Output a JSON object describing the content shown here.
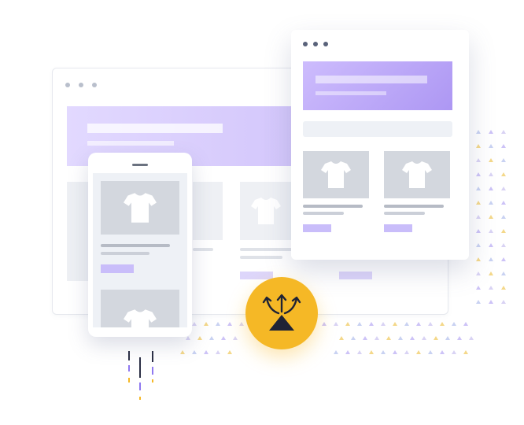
{
  "illustration": {
    "theme": "responsive-storefront",
    "colors": {
      "accent_purple": "#b7a4f6",
      "accent_yellow": "#f5b826",
      "placeholder_gray": "#d3d7de",
      "dark_navy": "#1f2335"
    },
    "icons": {
      "product": "tshirt-icon",
      "badge": "branching-arrows-icon"
    }
  }
}
